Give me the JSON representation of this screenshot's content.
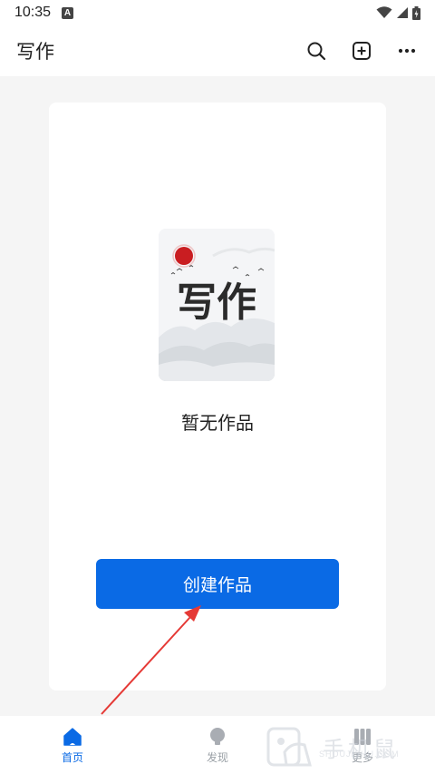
{
  "status_bar": {
    "time": "10:35",
    "notification_letter": "A"
  },
  "app_bar": {
    "title": "写作",
    "icons": [
      "search-icon",
      "add-square-icon",
      "more-icon"
    ]
  },
  "content": {
    "cover_title": "写作",
    "empty_text": "暂无作品",
    "create_button_label": "创建作品"
  },
  "bottom_nav": {
    "items": [
      {
        "label": "首页",
        "icon": "home-icon",
        "active": true
      },
      {
        "label": "发现",
        "icon": "bulb-icon",
        "active": false
      },
      {
        "label": "更多",
        "icon": "grid-icon",
        "active": false
      }
    ]
  },
  "watermark": {
    "text": "手机鼠",
    "sub": "SHOUJISHU.COM"
  },
  "colors": {
    "accent": "#0a6ae5",
    "annotation_arrow": "#e53935",
    "background": "#f5f5f5"
  }
}
